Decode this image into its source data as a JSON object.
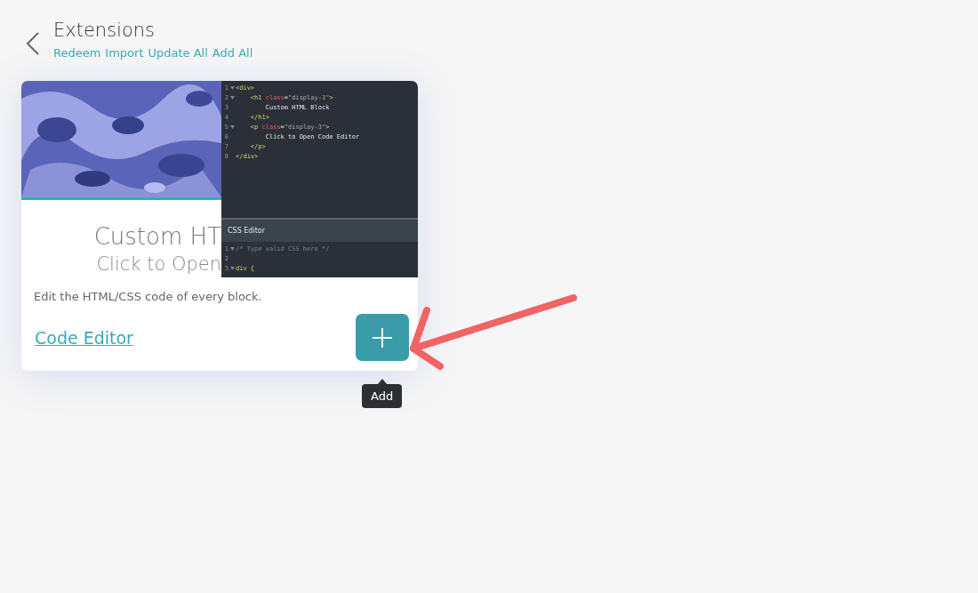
{
  "header": {
    "title": "Extensions",
    "links": [
      "Redeem",
      "Import",
      "Update All",
      "Add All"
    ]
  },
  "card": {
    "preview": {
      "heading": "Custom HT",
      "subheading": "Click to Open",
      "html_lines": [
        {
          "number": "1",
          "foldable": true,
          "parts": [
            {
              "kind": "tag",
              "text": "<div>"
            }
          ]
        },
        {
          "number": "2",
          "foldable": true,
          "parts": [
            {
              "kind": "tag",
              "text": "    <h1 "
            },
            {
              "kind": "attr",
              "text": "class"
            },
            {
              "kind": "plain",
              "text": "="
            },
            {
              "kind": "string",
              "text": "\"display-1\""
            },
            {
              "kind": "tag",
              "text": ">"
            }
          ]
        },
        {
          "number": "3",
          "foldable": false,
          "parts": [
            {
              "kind": "plain",
              "text": "        Custom HTML Block"
            }
          ]
        },
        {
          "number": "4",
          "foldable": false,
          "parts": [
            {
              "kind": "tag",
              "text": "    </h1>"
            }
          ]
        },
        {
          "number": "5",
          "foldable": true,
          "parts": [
            {
              "kind": "tag",
              "text": "    <p "
            },
            {
              "kind": "attr",
              "text": "class"
            },
            {
              "kind": "plain",
              "text": "="
            },
            {
              "kind": "string",
              "text": "\"display-3\""
            },
            {
              "kind": "tag",
              "text": ">"
            }
          ]
        },
        {
          "number": "6",
          "foldable": false,
          "parts": [
            {
              "kind": "plain",
              "text": "        Click to Open Code Editor"
            }
          ]
        },
        {
          "number": "7",
          "foldable": false,
          "parts": [
            {
              "kind": "tag",
              "text": "    </p>"
            }
          ]
        },
        {
          "number": "8",
          "foldable": false,
          "parts": [
            {
              "kind": "tag",
              "text": "</div>"
            }
          ]
        }
      ],
      "css_title": "CSS Editor",
      "css_lines": [
        {
          "number": "1",
          "foldable": true,
          "parts": [
            {
              "kind": "comment",
              "text": "/* Type valid CSS here */"
            }
          ]
        },
        {
          "number": "2",
          "foldable": false
        },
        {
          "number": "3",
          "foldable": true,
          "parts": [
            {
              "kind": "tag",
              "text": "div {"
            }
          ]
        }
      ]
    },
    "description": "Edit the HTML/CSS code of every block.",
    "name": "Code Editor",
    "tooltip": "Add"
  }
}
